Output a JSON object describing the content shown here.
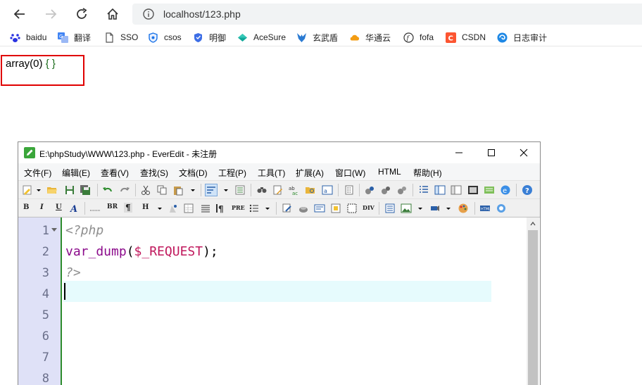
{
  "browser": {
    "url": "localhost/123.php",
    "bookmarks": [
      {
        "label": "baidu",
        "icon": "paw-icon",
        "color": "#2932e1"
      },
      {
        "label": "翻译",
        "icon": "translate-icon",
        "color": "#4285f4"
      },
      {
        "label": "SSO",
        "icon": "page-icon",
        "color": "#555555"
      },
      {
        "label": "csos",
        "icon": "shield-icon",
        "color": "#1a73e8"
      },
      {
        "label": "明御",
        "icon": "shield-icon",
        "color": "#3d6ee6"
      },
      {
        "label": "AceSure",
        "icon": "diamond-icon",
        "color": "#11a89a"
      },
      {
        "label": "玄武盾",
        "icon": "fox-icon",
        "color": "#2a7ad2"
      },
      {
        "label": "华通云",
        "icon": "cloud-icon",
        "color": "#f39c12"
      },
      {
        "label": "fofa",
        "icon": "f-icon",
        "color": "#333333"
      },
      {
        "label": "CSDN",
        "icon": "c-icon",
        "color": "#fc5531"
      },
      {
        "label": "日志审计",
        "icon": "swirl-icon",
        "color": "#1e88e5"
      }
    ]
  },
  "page": {
    "output_prefix": "array(0) ",
    "output_braces": "{ }"
  },
  "everedit": {
    "title": "E:\\phpStudy\\WWW\\123.php - EverEdit - 未注册",
    "menu": [
      "文件(F)",
      "编辑(E)",
      "查看(V)",
      "查找(S)",
      "文档(D)",
      "工程(P)",
      "工具(T)",
      "扩展(A)",
      "窗口(W)",
      "HTML",
      "帮助(H)"
    ],
    "format_labels": {
      "bold": "B",
      "italic": "I",
      "underline": "U",
      "br": "BR",
      "pilcrow": "¶",
      "heading": "H",
      "pre": "PRE",
      "div": "DIV"
    },
    "line_numbers": [
      "1",
      "2",
      "3",
      "4",
      "5",
      "6",
      "7",
      "8"
    ],
    "code": {
      "line1": "<?php",
      "line2_fn": "var_dump",
      "line2_open": "(",
      "line2_var": "$_REQUEST",
      "line2_close": ");",
      "line3": "?>"
    }
  }
}
